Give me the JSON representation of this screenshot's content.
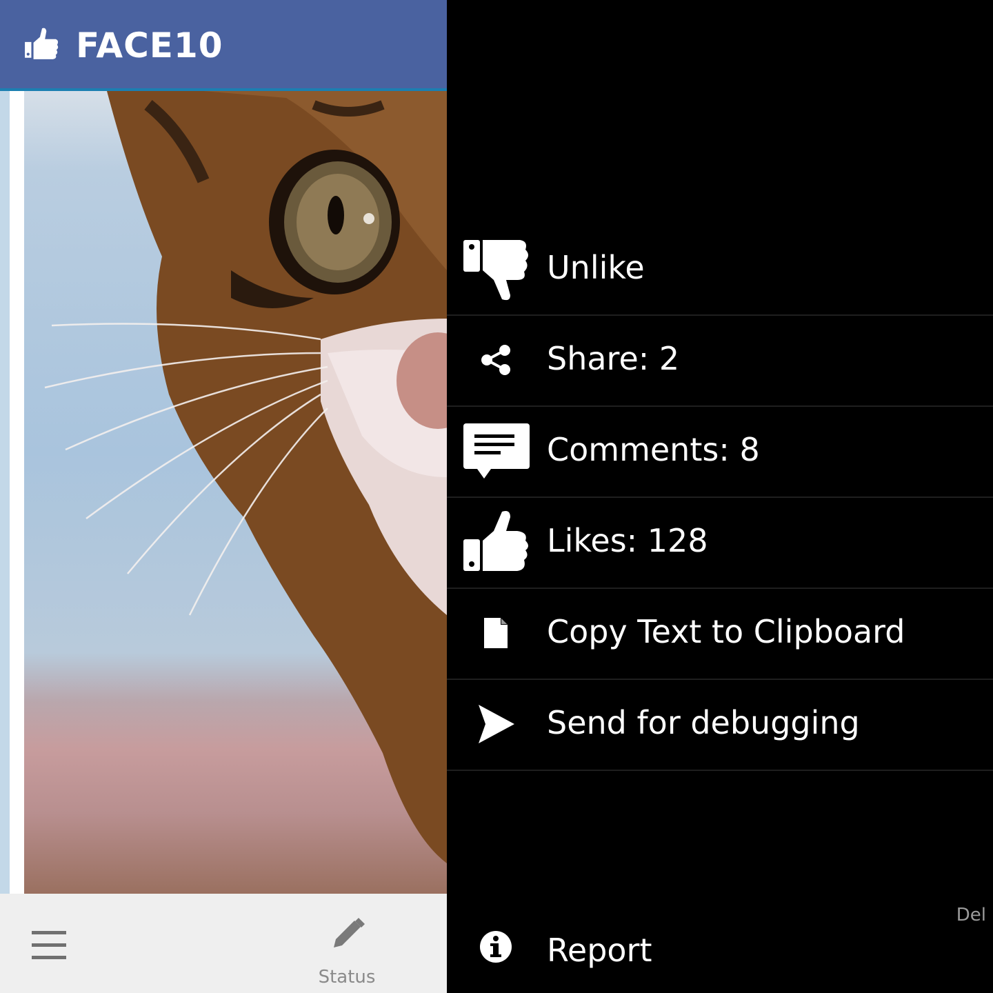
{
  "app": {
    "title": "FACE10",
    "logo_icon": "thumbs-up-icon",
    "brand_color": "#4a62a0"
  },
  "bottom_bar": {
    "menu_icon": "hamburger-menu-icon",
    "status_label": "Status",
    "status_icon": "pencil-icon"
  },
  "actions": [
    {
      "label": "Unlike",
      "icon": "thumbs-down-icon"
    },
    {
      "label": "Share: 2",
      "icon": "share-icon"
    },
    {
      "label": "Comments: 8",
      "icon": "comment-icon"
    },
    {
      "label": "Likes: 128",
      "icon": "thumbs-up-icon"
    },
    {
      "label": "Copy Text to Clipboard",
      "icon": "document-icon"
    },
    {
      "label": "Send for debugging",
      "icon": "send-icon"
    }
  ],
  "report": {
    "label": "Report",
    "icon": "info-icon",
    "del_label": "Del"
  }
}
